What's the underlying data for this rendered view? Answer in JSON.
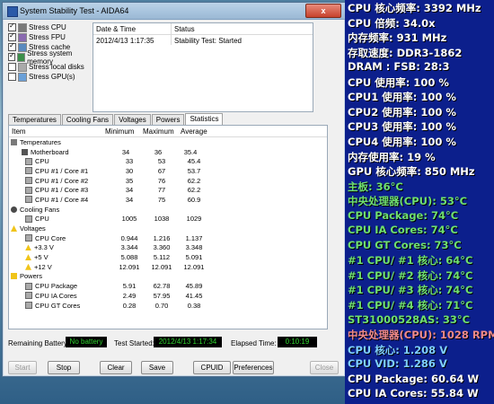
{
  "window": {
    "title": "System Stability Test - AIDA64",
    "close_label": "x"
  },
  "stress_items": [
    {
      "label": "Stress CPU",
      "checked": true,
      "icon": "cpu-icon"
    },
    {
      "label": "Stress FPU",
      "checked": true,
      "icon": "fpu-icon"
    },
    {
      "label": "Stress cache",
      "checked": true,
      "icon": "cache-icon"
    },
    {
      "label": "Stress system memory",
      "checked": true,
      "icon": "memory-icon"
    },
    {
      "label": "Stress local disks",
      "checked": false,
      "icon": "disk-icon"
    },
    {
      "label": "Stress GPU(s)",
      "checked": false,
      "icon": "gpu-icon"
    }
  ],
  "status_table": {
    "headers": [
      "Date & Time",
      "Status"
    ],
    "rows": [
      [
        "2012/4/13 1:17:35",
        "Stability Test: Started"
      ]
    ]
  },
  "tabs": [
    "Temperatures",
    "Cooling Fans",
    "Voltages",
    "Powers",
    "Statistics"
  ],
  "active_tab": "Statistics",
  "stats": {
    "headers": [
      "Item",
      "Minimum",
      "Maximum",
      "Average"
    ],
    "rows": [
      {
        "label": "Temperatures",
        "kind": "cat",
        "icon": "thermometer-icon",
        "min": "",
        "max": "",
        "avg": ""
      },
      {
        "label": "Motherboard",
        "kind": "item1",
        "icon": "motherboard-icon",
        "min": "34",
        "max": "36",
        "avg": "35.4"
      },
      {
        "label": "CPU",
        "kind": "item",
        "icon": "cpu-icon",
        "min": "33",
        "max": "53",
        "avg": "45.4"
      },
      {
        "label": "CPU #1 / Core #1",
        "kind": "item",
        "icon": "cpu-icon",
        "min": "30",
        "max": "67",
        "avg": "53.7"
      },
      {
        "label": "CPU #1 / Core #2",
        "kind": "item",
        "icon": "cpu-icon",
        "min": "35",
        "max": "76",
        "avg": "62.2"
      },
      {
        "label": "CPU #1 / Core #3",
        "kind": "item",
        "icon": "cpu-icon",
        "min": "34",
        "max": "77",
        "avg": "62.2"
      },
      {
        "label": "CPU #1 / Core #4",
        "kind": "item",
        "icon": "cpu-icon",
        "min": "34",
        "max": "75",
        "avg": "60.9"
      },
      {
        "label": "Cooling Fans",
        "kind": "cat",
        "icon": "fan-icon",
        "min": "",
        "max": "",
        "avg": ""
      },
      {
        "label": "CPU",
        "kind": "item",
        "icon": "cpu-icon",
        "min": "1005",
        "max": "1038",
        "avg": "1029"
      },
      {
        "label": "Voltages",
        "kind": "cat",
        "icon": "warning-icon",
        "min": "",
        "max": "",
        "avg": ""
      },
      {
        "label": "CPU Core",
        "kind": "item",
        "icon": "cpu-icon",
        "min": "0.944",
        "max": "1.216",
        "avg": "1.137"
      },
      {
        "label": "+3.3 V",
        "kind": "item",
        "icon": "warning-icon",
        "min": "3.344",
        "max": "3.360",
        "avg": "3.348"
      },
      {
        "label": "+5 V",
        "kind": "item",
        "icon": "warning-icon",
        "min": "5.088",
        "max": "5.112",
        "avg": "5.091"
      },
      {
        "label": "+12 V",
        "kind": "item",
        "icon": "warning-icon",
        "min": "12.091",
        "max": "12.091",
        "avg": "12.091"
      },
      {
        "label": "Powers",
        "kind": "cat",
        "icon": "power-icon",
        "min": "",
        "max": "",
        "avg": ""
      },
      {
        "label": "CPU Package",
        "kind": "item",
        "icon": "cpu-icon",
        "min": "5.91",
        "max": "62.78",
        "avg": "45.89"
      },
      {
        "label": "CPU IA Cores",
        "kind": "item",
        "icon": "cpu-icon",
        "min": "2.49",
        "max": "57.95",
        "avg": "41.45"
      },
      {
        "label": "CPU GT Cores",
        "kind": "item",
        "icon": "cpu-icon",
        "min": "0.28",
        "max": "0.70",
        "avg": "0.38"
      }
    ]
  },
  "bottom": {
    "remaining_battery_label": "Remaining Battery:",
    "remaining_battery_value": "No battery",
    "test_started_label": "Test Started:",
    "test_started_value": "2012/4/13 1:17:34",
    "elapsed_label": "Elapsed Time:",
    "elapsed_value": "0:10:19"
  },
  "buttons": {
    "start": "Start",
    "stop": "Stop",
    "clear": "Clear",
    "save": "Save",
    "cpuid": "CPUID",
    "preferences": "Preferences",
    "close": "Close"
  },
  "overlay_lines": [
    {
      "text": "CPU 核心频率: 3392 MHz",
      "color": "#ffffff"
    },
    {
      "text": "CPU 倍频: 34.0x",
      "color": "#ffffff"
    },
    {
      "text": "内存频率: 931 MHz",
      "color": "#ffffff"
    },
    {
      "text": "存取速度: DDR3-1862",
      "color": "#ffffff"
    },
    {
      "text": "DRAM : FSB: 28:3",
      "color": "#ffffff"
    },
    {
      "text": "CPU 使用率: 100 %",
      "color": "#ffffff"
    },
    {
      "text": "CPU1 使用率: 100 %",
      "color": "#ffffff"
    },
    {
      "text": "CPU2 使用率: 100 %",
      "color": "#ffffff"
    },
    {
      "text": "CPU3 使用率: 100 %",
      "color": "#ffffff"
    },
    {
      "text": "CPU4 使用率: 100 %",
      "color": "#ffffff"
    },
    {
      "text": "内存使用率: 19 %",
      "color": "#ffffff"
    },
    {
      "text": "GPU 核心频率: 850 MHz",
      "color": "#ffffff"
    },
    {
      "text": "主板: 36°C",
      "color": "#6fe06f"
    },
    {
      "text": "中央处理器(CPU): 53°C",
      "color": "#6fe06f"
    },
    {
      "text": "CPU Package: 74°C",
      "color": "#6fe06f"
    },
    {
      "text": "CPU IA Cores: 74°C",
      "color": "#6fe06f"
    },
    {
      "text": "CPU GT Cores: 73°C",
      "color": "#6fe06f"
    },
    {
      "text": "#1 CPU/ #1 核心: 64°C",
      "color": "#6fe06f"
    },
    {
      "text": "#1 CPU/ #2 核心: 74°C",
      "color": "#6fe06f"
    },
    {
      "text": "#1 CPU/ #3 核心: 74°C",
      "color": "#6fe06f"
    },
    {
      "text": "#1 CPU/ #4 核心: 71°C",
      "color": "#6fe06f"
    },
    {
      "text": "ST31000528AS: 33°C",
      "color": "#6fe06f"
    },
    {
      "text": "中央处理器(CPU): 1028 RPM",
      "color": "#f08a8a"
    },
    {
      "text": "CPU 核心: 1.208 V",
      "color": "#7fd0ff"
    },
    {
      "text": "CPU VID: 1.286 V",
      "color": "#7fd0ff"
    },
    {
      "text": "CPU Package: 60.64 W",
      "color": "#ffffff"
    },
    {
      "text": "CPU IA Cores: 55.84 W",
      "color": "#ffffff"
    }
  ]
}
